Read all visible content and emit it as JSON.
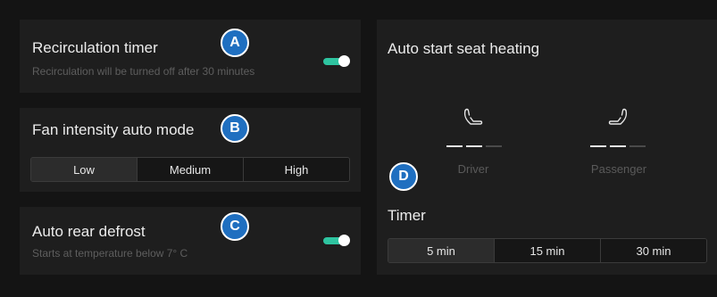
{
  "recirculation": {
    "title": "Recirculation timer",
    "subtitle": "Recirculation will be turned off after 30 minutes",
    "toggle_on": true,
    "badge": "A"
  },
  "fan": {
    "title": "Fan intensity auto mode",
    "options": [
      "Low",
      "Medium",
      "High"
    ],
    "selected": "Low",
    "badge": "B"
  },
  "defrost": {
    "title": "Auto rear defrost",
    "subtitle": "Starts at temperature below 7° C",
    "toggle_on": true,
    "badge": "C"
  },
  "seat_heating": {
    "title": "Auto start seat heating",
    "driver": {
      "label": "Driver",
      "level": 2,
      "max": 3
    },
    "passenger": {
      "label": "Passenger",
      "level": 2,
      "max": 3
    },
    "badge": "D"
  },
  "timer": {
    "title": "Timer",
    "options": [
      "5 min",
      "15 min",
      "30 min"
    ],
    "selected": "5 min"
  },
  "colors": {
    "toggle_on": "#2ec4a0",
    "badge": "#1f6fc0",
    "card": "#1e1e1e",
    "background": "#141414"
  }
}
